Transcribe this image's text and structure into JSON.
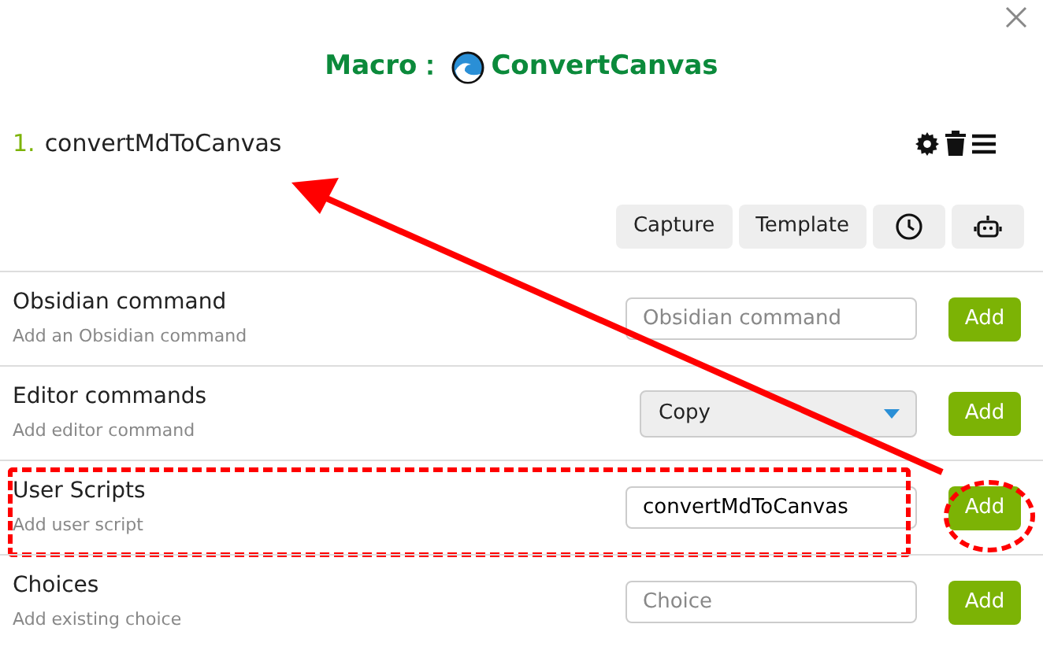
{
  "title": {
    "prefix": "Macro：",
    "name": "ConvertCanvas"
  },
  "commands": [
    {
      "index": "1.",
      "name": "convertMdToCanvas"
    }
  ],
  "toolbar_buttons": [
    "Capture",
    "Template"
  ],
  "rows": [
    {
      "title": "Obsidian command",
      "description": "Add an Obsidian command",
      "kind": "text",
      "placeholder": "Obsidian command",
      "button": "Add",
      "highlighted": false
    },
    {
      "title": "Editor commands",
      "description": "Add editor command",
      "kind": "select",
      "value": "Copy",
      "button": "Add",
      "highlighted": false
    },
    {
      "title": "User Scripts",
      "description": "Add user script",
      "kind": "text",
      "value": "convertMdToCanvas",
      "button": "Add",
      "highlighted": true
    },
    {
      "title": "Choices",
      "description": "Add existing choice",
      "kind": "text",
      "placeholder": "Choice",
      "button": "Add",
      "highlighted": false
    }
  ]
}
